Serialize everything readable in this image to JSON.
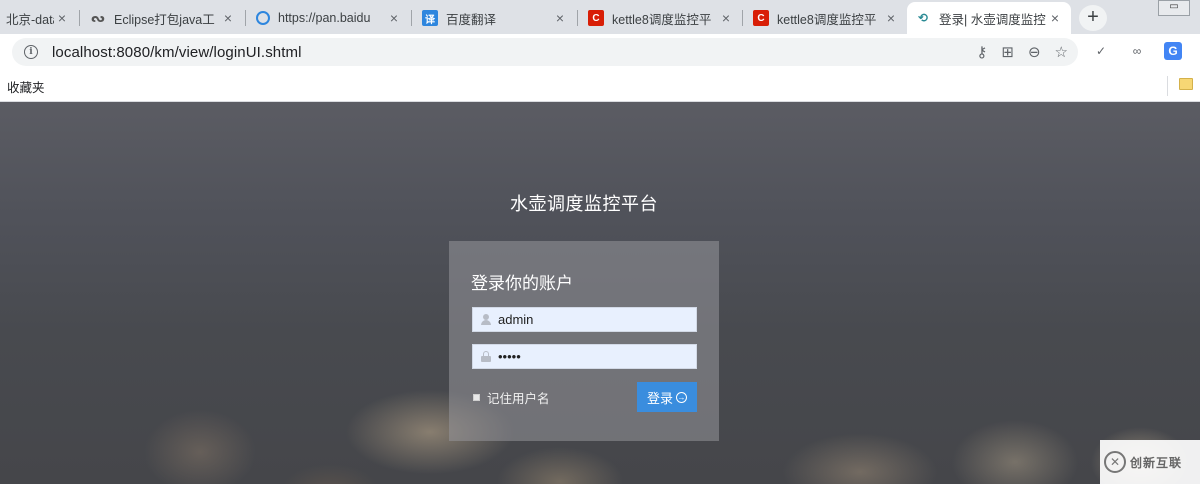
{
  "browser": {
    "tabs": [
      {
        "title": "北京-data",
        "favicon": "document-icon",
        "active": false
      },
      {
        "title": "Eclipse打包java工",
        "favicon": "eclipse-icon",
        "active": false
      },
      {
        "title": "https://pan.baidu",
        "favicon": "baidu-pan-icon",
        "active": false
      },
      {
        "title": "百度翻译",
        "favicon": "translate-icon",
        "active": false
      },
      {
        "title": "kettle8调度监控平",
        "favicon": "csdn-icon",
        "active": false
      },
      {
        "title": "kettle8调度监控平",
        "favicon": "csdn-icon",
        "active": false
      },
      {
        "title": "登录| 水壶调度监控",
        "favicon": "login-icon",
        "active": true
      }
    ],
    "tab_close_glyph": "×",
    "new_tab_glyph": "+",
    "translate_favicon_glyph": "译",
    "csdn_favicon_glyph": "C",
    "url": "localhost:8080/km/view/loginUI.shtml",
    "bookmarks_label": "收藏夹"
  },
  "page": {
    "site_title": "水壶调度监控平台",
    "login": {
      "heading": "登录你的账户",
      "username_value": "admin",
      "password_value": "•••••",
      "remember_label": "记住用户名",
      "submit_label": "登录"
    }
  },
  "watermark": {
    "text": "创新互联"
  },
  "colors": {
    "accent": "#3a8dde",
    "tabstrip": "#dee1e6",
    "field_bg": "#e8f0fe"
  }
}
